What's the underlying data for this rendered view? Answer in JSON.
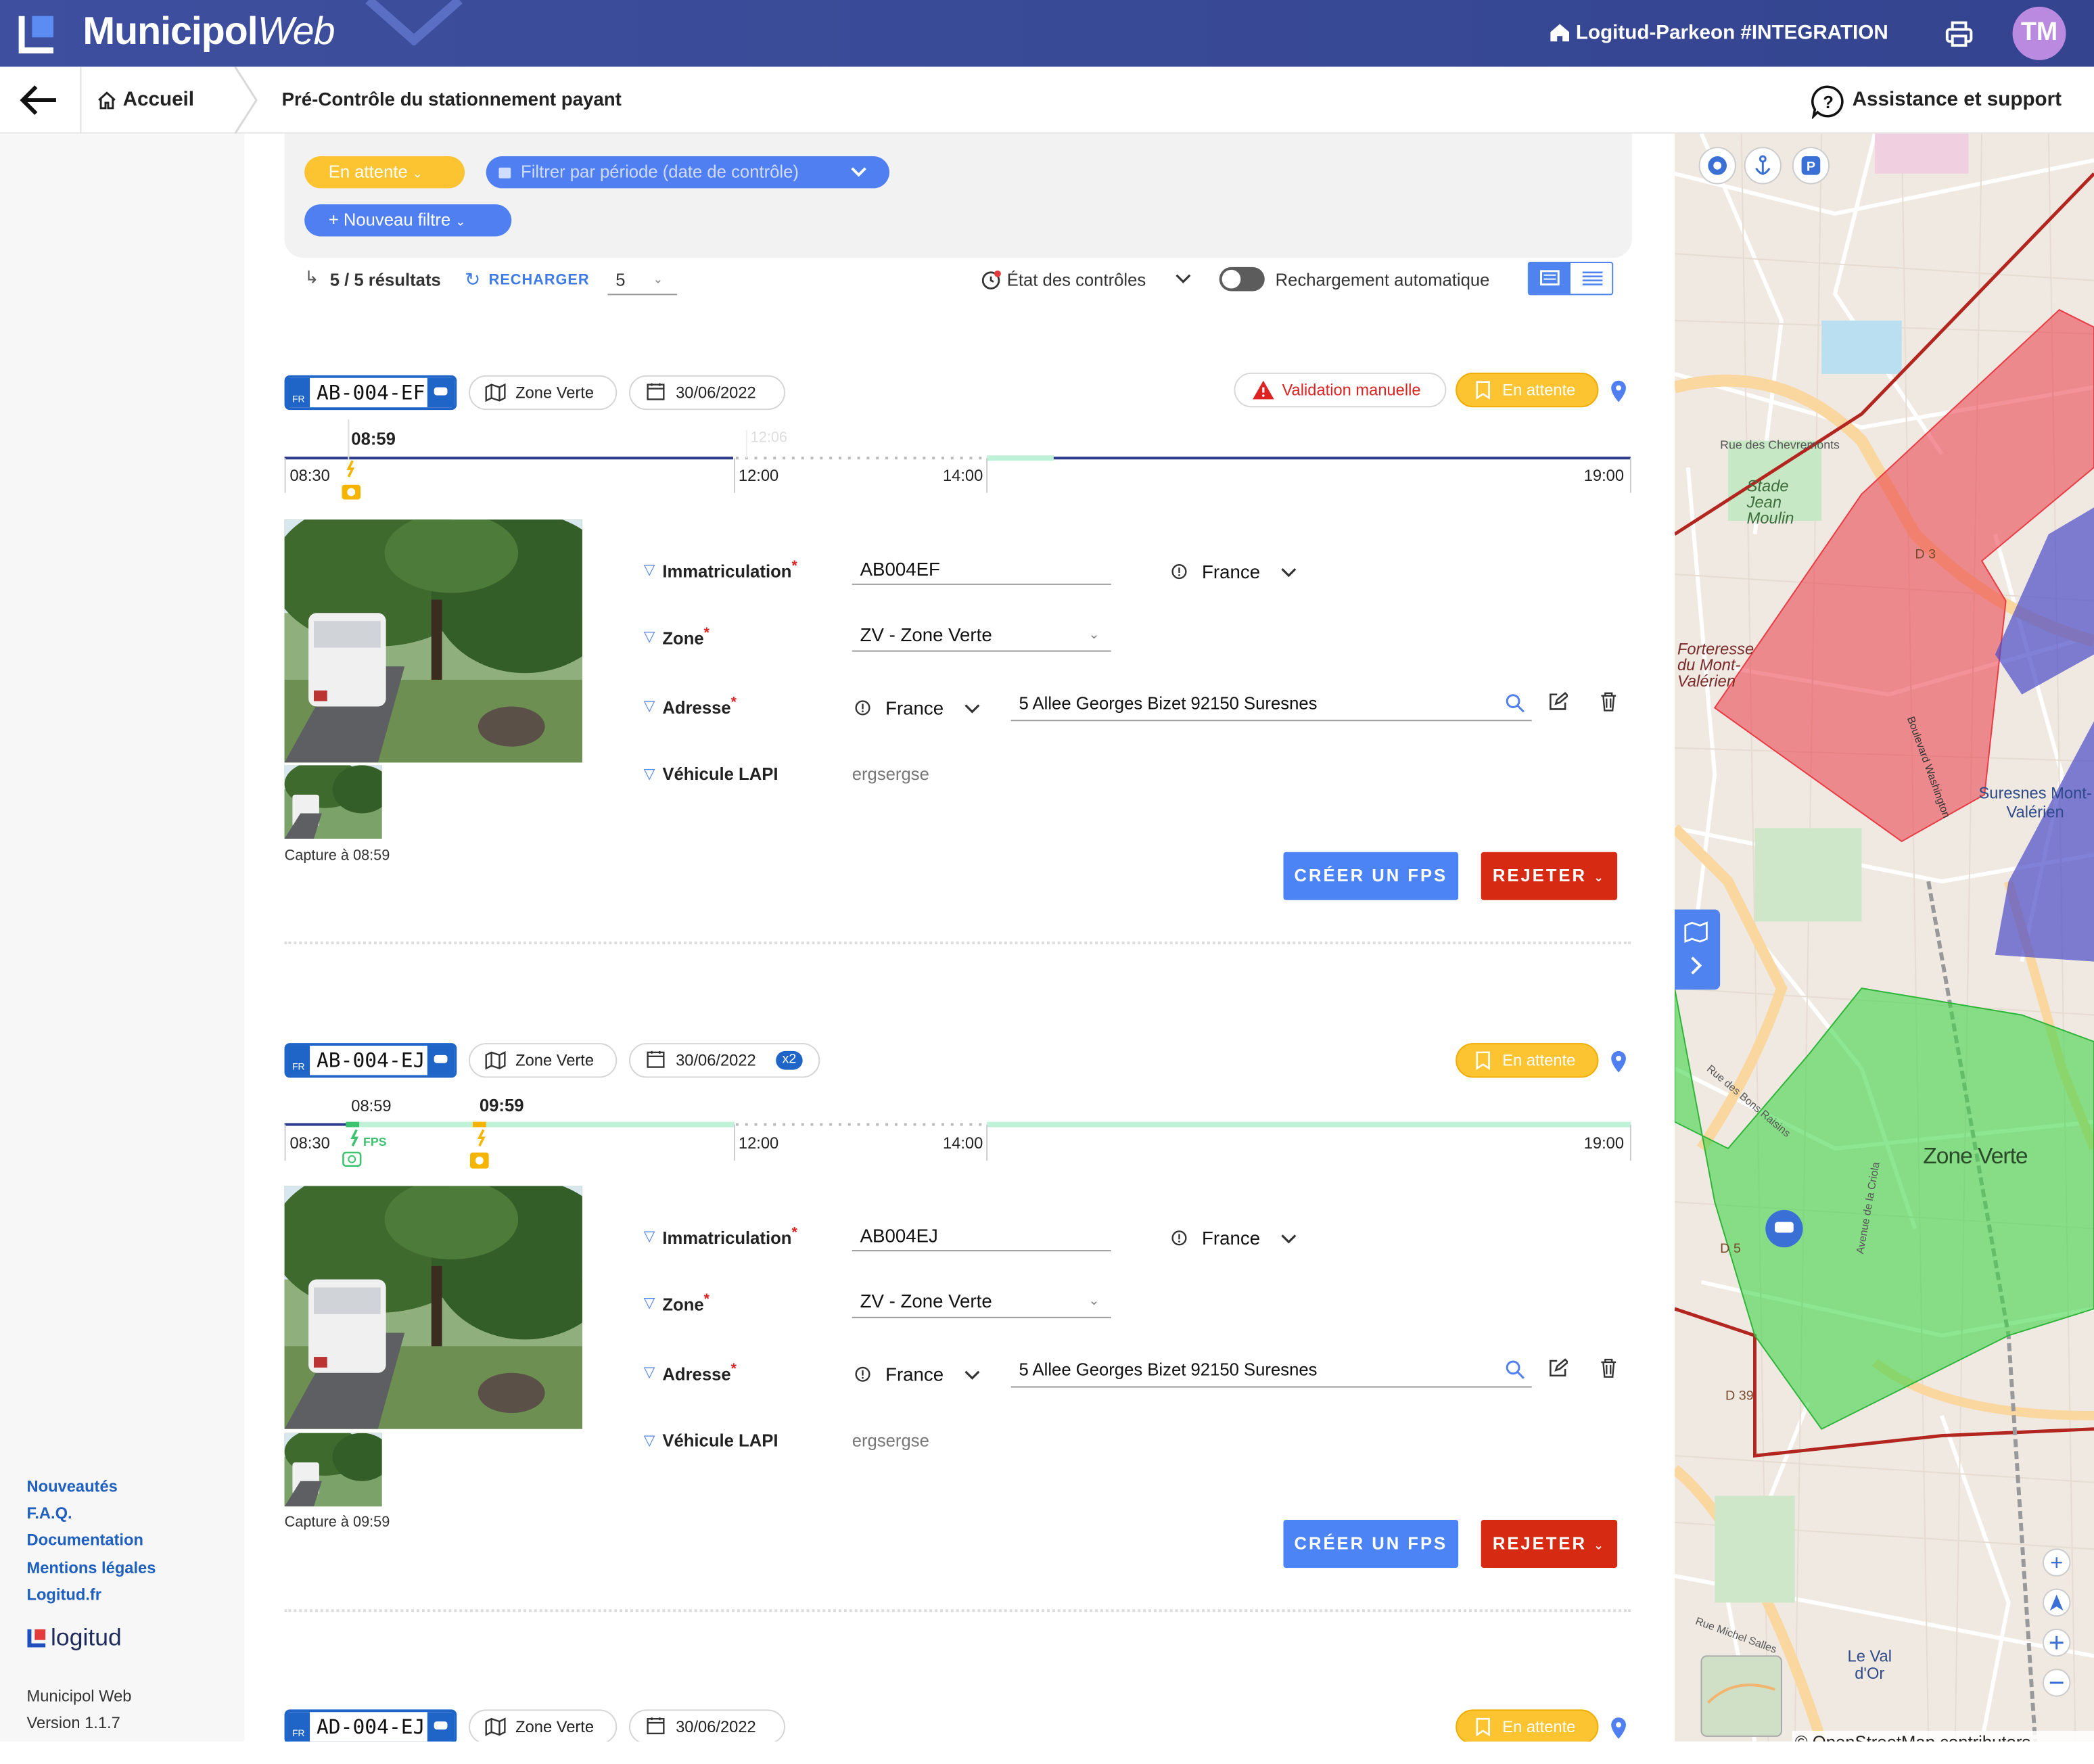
{
  "app": {
    "brand_main": "Municipol",
    "brand_web": "Web",
    "tenant": "Logitud-Parkeon #INTEGRATION",
    "user_initials": "TM"
  },
  "nav": {
    "home": "Accueil",
    "page_title": "Pré-Contrôle du stationnement payant",
    "support": "Assistance et support"
  },
  "sidebar": {
    "links": [
      "Nouveautés",
      "F.A.Q.",
      "Documentation",
      "Mentions légales",
      "Logitud.fr"
    ],
    "logo_text": "logitud",
    "app_name": "Municipol Web",
    "version": "Version 1.1.7"
  },
  "filters": {
    "status_filter": "En attente",
    "period_filter": "Filtrer par période (date de contrôle)",
    "new_filter": "+ Nouveau filtre"
  },
  "results": {
    "count": "5 / 5 résultats",
    "reload": "RECHARGER",
    "page_size": "5",
    "state_label": "État des contrôles",
    "auto_reload": "Rechargement automatique"
  },
  "cards": [
    {
      "plate": "AB-004-EF",
      "country_code": "FR",
      "zone": "Zone Verte",
      "date": "30/06/2022",
      "date_badge": "",
      "warning": "Validation manuelle",
      "status": "En attente",
      "timeline": {
        "start": "08:30",
        "t1": "12:00",
        "t2": "14:00",
        "end": "19:00",
        "capture_time": "08:59",
        "ghost_time": "12:06",
        "event1": "",
        "fps_label": ""
      },
      "form": {
        "plate_label": "Immatriculation",
        "plate_value": "AB004EF",
        "country": "France",
        "zone_label": "Zone",
        "zone_value": "ZV - Zone Verte",
        "address_label": "Adresse",
        "address_country": "France",
        "address_value": "5 Allee Georges Bizet 92150 Suresnes",
        "lapi_label": "Véhicule LAPI",
        "lapi_value": "ergsergse"
      },
      "caption": "Capture à 08:59",
      "btn_fps": "CRÉER UN FPS",
      "btn_reject": "REJETER"
    },
    {
      "plate": "AB-004-EJ",
      "country_code": "FR",
      "zone": "Zone Verte",
      "date": "30/06/2022",
      "date_badge": "x2",
      "warning": "",
      "status": "En attente",
      "timeline": {
        "start": "08:30",
        "t1": "12:00",
        "t2": "14:00",
        "end": "19:00",
        "capture_time": "09:59",
        "ghost_time": "",
        "event1": "08:59",
        "fps_label": "FPS"
      },
      "form": {
        "plate_label": "Immatriculation",
        "plate_value": "AB004EJ",
        "country": "France",
        "zone_label": "Zone",
        "zone_value": "ZV - Zone Verte",
        "address_label": "Adresse",
        "address_country": "France",
        "address_value": "5 Allee Georges Bizet 92150 Suresnes",
        "lapi_label": "Véhicule LAPI",
        "lapi_value": "ergsergse"
      },
      "caption": "Capture à 09:59",
      "btn_fps": "CRÉER UN FPS",
      "btn_reject": "REJETER"
    },
    {
      "plate": "AD-004-EJ",
      "country_code": "FR",
      "zone": "Zone Verte",
      "date": "30/06/2022",
      "date_badge": "",
      "warning": "",
      "status": "En attente"
    }
  ],
  "map": {
    "labels": [
      "Zone Verte",
      "Stade Jean Moulin",
      "Forteresse du Mont-Valérien",
      "Suresnes Mont-Valérien",
      "Le Val d'Or",
      "Rue des Chevremonts",
      "Rue des Bons Raisins",
      "Avenue de la Criola",
      "Rue Michel Salles",
      "D 3",
      "D 5",
      "D 39",
      "Boulevard Washington"
    ],
    "attribution": "© OpenStreetMap contributors.",
    "colors": {
      "green_zone": "#3fd64a",
      "red_zone": "#ea3b45",
      "blue_zone": "#4c4cc8"
    }
  }
}
